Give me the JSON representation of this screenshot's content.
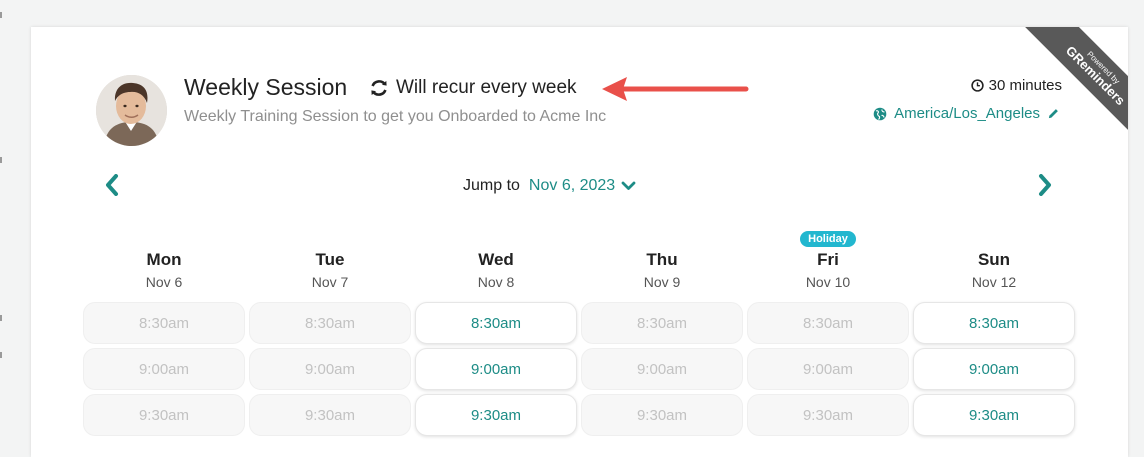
{
  "session": {
    "title": "Weekly Session",
    "recurrence": "Will recur every week",
    "description": "Weekly Training Session to get you Onboarded to Acme Inc",
    "duration": "30 minutes",
    "timezone": "America/Los_Angeles"
  },
  "ribbon": {
    "small_text": "Powered by",
    "brand": "GReminders"
  },
  "navigation": {
    "jump_label": "Jump to",
    "jump_date": "Nov 6, 2023"
  },
  "colors": {
    "accent": "#1d8c86",
    "badge": "#22b7cf",
    "arrow": "#e9504a",
    "ribbon": "#595959"
  },
  "icons": [
    "refresh-icon",
    "clock-icon",
    "globe-icon",
    "pencil-icon",
    "chevron-left-icon",
    "chevron-right-icon",
    "chevron-down-icon",
    "red-annotation-arrow"
  ],
  "days": [
    {
      "name": "Mon",
      "date": "Nov 6",
      "badge": "",
      "slots": [
        {
          "time": "8:30am",
          "available": false
        },
        {
          "time": "9:00am",
          "available": false
        },
        {
          "time": "9:30am",
          "available": false
        }
      ]
    },
    {
      "name": "Tue",
      "date": "Nov 7",
      "badge": "",
      "slots": [
        {
          "time": "8:30am",
          "available": false
        },
        {
          "time": "9:00am",
          "available": false
        },
        {
          "time": "9:30am",
          "available": false
        }
      ]
    },
    {
      "name": "Wed",
      "date": "Nov 8",
      "badge": "",
      "slots": [
        {
          "time": "8:30am",
          "available": true
        },
        {
          "time": "9:00am",
          "available": true
        },
        {
          "time": "9:30am",
          "available": true
        }
      ]
    },
    {
      "name": "Thu",
      "date": "Nov 9",
      "badge": "",
      "slots": [
        {
          "time": "8:30am",
          "available": false
        },
        {
          "time": "9:00am",
          "available": false
        },
        {
          "time": "9:30am",
          "available": false
        }
      ]
    },
    {
      "name": "Fri",
      "date": "Nov 10",
      "badge": "Holiday",
      "slots": [
        {
          "time": "8:30am",
          "available": false
        },
        {
          "time": "9:00am",
          "available": false
        },
        {
          "time": "9:30am",
          "available": false
        }
      ]
    },
    {
      "name": "Sun",
      "date": "Nov 12",
      "badge": "",
      "slots": [
        {
          "time": "8:30am",
          "available": true
        },
        {
          "time": "9:00am",
          "available": true
        },
        {
          "time": "9:30am",
          "available": true
        }
      ]
    }
  ]
}
